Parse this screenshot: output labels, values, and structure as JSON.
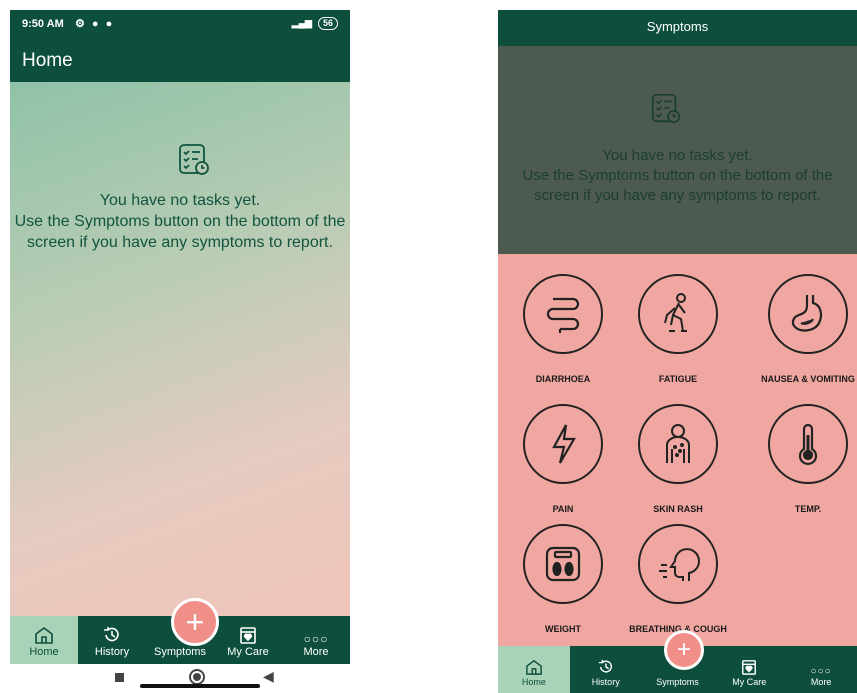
{
  "left": {
    "status_bar": {
      "time": "9:50 AM",
      "battery": "56"
    },
    "header": {
      "title": "Home"
    },
    "empty_state": {
      "text": "You have no tasks yet.\nUse the Symptoms button on the bottom of the screen if you have any symptoms to report."
    },
    "nav": {
      "home": "Home",
      "history": "History",
      "symptoms": "Symptoms",
      "my_care": "My Care",
      "more": "More"
    },
    "fab": "+"
  },
  "right": {
    "header": {
      "title": "Symptoms"
    },
    "empty_state": {
      "text": "You have no tasks yet.\nUse the Symptoms button on the bottom of the screen if you have any symptoms to report."
    },
    "symptoms": [
      {
        "label": "DIARRHOEA",
        "icon": "intestine-icon"
      },
      {
        "label": "FATIGUE",
        "icon": "tired-person-icon"
      },
      {
        "label": "NAUSEA & VOMITING",
        "icon": "stomach-icon"
      },
      {
        "label": "PAIN",
        "icon": "lightning-icon"
      },
      {
        "label": "SKIN RASH",
        "icon": "rash-person-icon"
      },
      {
        "label": "TEMP.",
        "icon": "thermometer-icon"
      },
      {
        "label": "WEIGHT",
        "icon": "scale-icon"
      },
      {
        "label": "BREATHING & COUGH",
        "icon": "cough-head-icon"
      }
    ],
    "nav": {
      "home": "Home",
      "history": "History",
      "symptoms": "Symptoms",
      "my_care": "My Care",
      "more": "More"
    },
    "fab": "+"
  },
  "colors": {
    "primary": "#0d4f3c",
    "accent": "#ef8f88",
    "panel": "#f0a7a1",
    "active_tab": "#a8d3b9"
  }
}
